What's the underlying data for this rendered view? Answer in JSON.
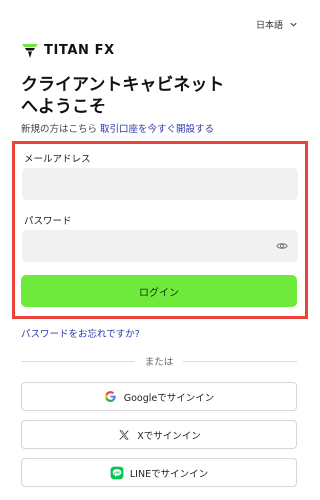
{
  "language": {
    "selected": "日本語"
  },
  "brand": {
    "logo_text": "TITAN FX",
    "accent": "#6eea3c"
  },
  "heading": {
    "line1": "クライアントキャビネット",
    "line2": "へようこそ"
  },
  "signup": {
    "prompt": "新規の方はこちら",
    "link": "取引口座を今すぐ開設する"
  },
  "form": {
    "email_label": "メールアドレス",
    "email_value": "",
    "password_label": "パスワード",
    "password_value": "",
    "login_label": "ログイン"
  },
  "forgot_password": "パスワードをお忘れですか?",
  "divider_text": "または",
  "social": {
    "google_label": "Googleでサインイン",
    "x_label": "Xでサインイン",
    "line_label": "LINEでサインイン"
  },
  "icons": [
    "chevron-down-icon",
    "titan-logo-icon",
    "eye-icon",
    "google-icon",
    "x-icon",
    "line-icon"
  ],
  "colors": {
    "highlight_border": "#e8443b",
    "link": "#2c3aa8",
    "login_button": "#6eea3c"
  }
}
